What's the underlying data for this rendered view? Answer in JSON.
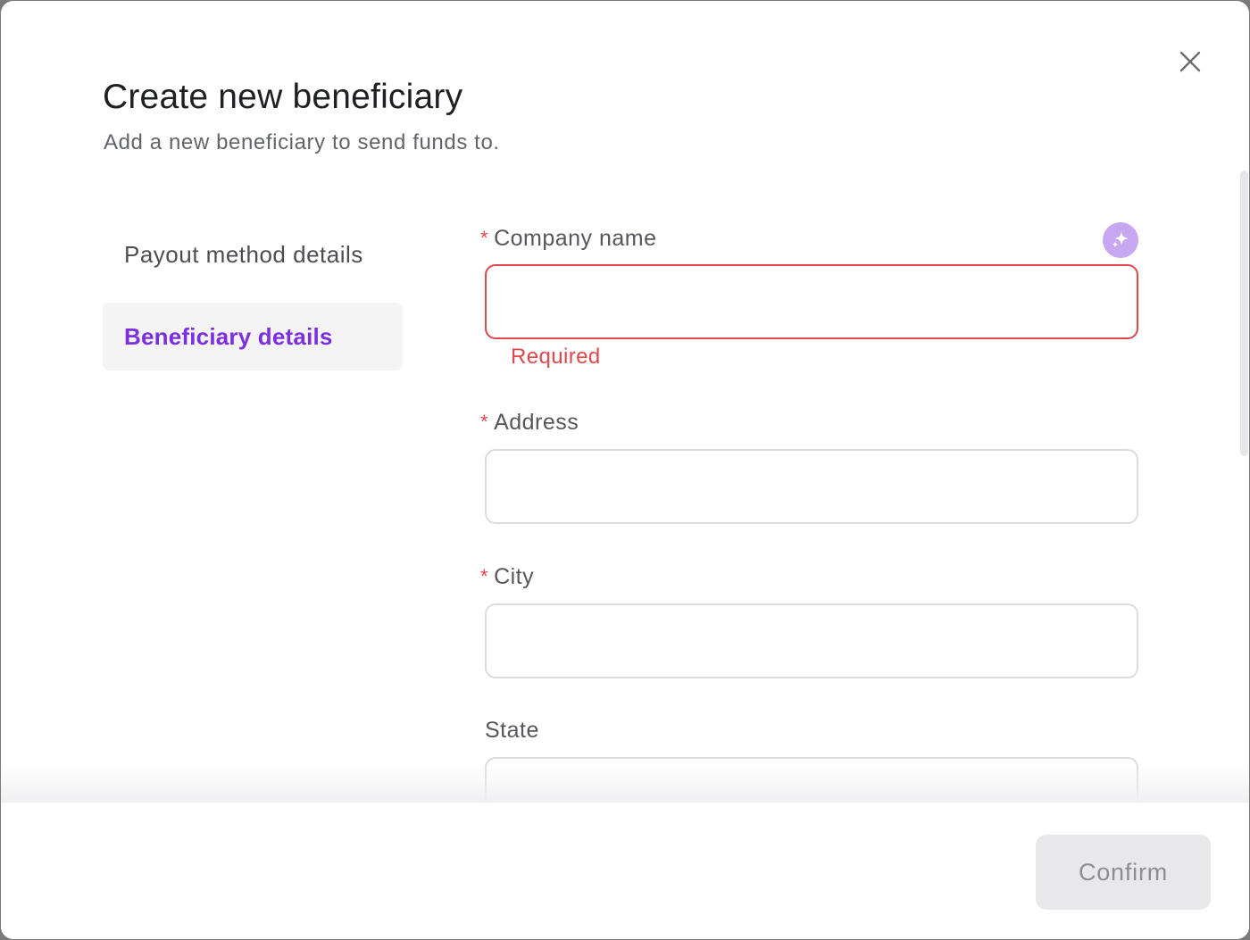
{
  "modal": {
    "title": "Create new beneficiary",
    "subtitle": "Add a new beneficiary to send funds to.",
    "close_icon": "close-icon"
  },
  "steps": [
    {
      "label": "Payout method details",
      "active": false
    },
    {
      "label": "Beneficiary details",
      "active": true
    }
  ],
  "form": {
    "company_name": {
      "label": "Company name",
      "required": true,
      "value": "",
      "error": "Required"
    },
    "address": {
      "label": "Address",
      "required": true,
      "value": ""
    },
    "city": {
      "label": "City",
      "required": true,
      "value": ""
    },
    "state": {
      "label": "State",
      "required": false,
      "value": ""
    },
    "required_marker": "*",
    "ai_assist_icon": "sparkle-icon"
  },
  "footer": {
    "confirm_label": "Confirm",
    "confirm_disabled": true
  },
  "colors": {
    "accent": "#7b2fe0",
    "error": "#e0474c",
    "ai_button": "#c7a6f2",
    "disabled_button": "#e8e8ea"
  }
}
